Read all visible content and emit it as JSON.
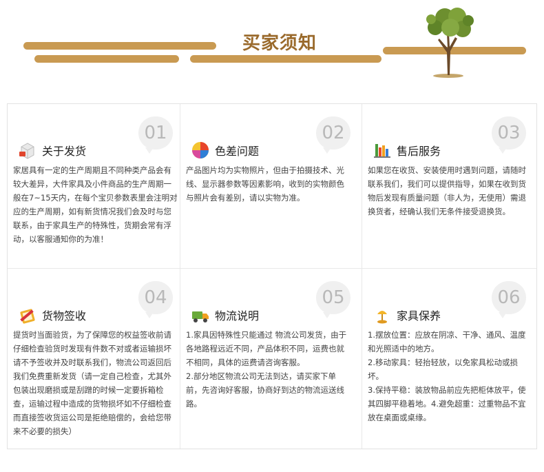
{
  "banner": {
    "title": "买家须知"
  },
  "sections": [
    {
      "number": "01",
      "title": "关于发货",
      "icon": "box-package-icon",
      "text": "家居具有一定的生产周期且不同种类产品会有较大差异，大件家具及小件商品的生产周期一般在7~15天内，在每个宝贝参数表里会注明对应的生产周期，如有新货情况我们会及时与您联系，由于家具生产的特殊性，货期会常有浮动，以客服通知你的为准！"
    },
    {
      "number": "02",
      "title": "色差问题",
      "icon": "color-ball-icon",
      "text": "产品图片均为实物照片，但由于拍摄技术、光线、显示器参数等因素影响，收到的实物颜色与照片会有差别，请以实物为准。"
    },
    {
      "number": "03",
      "title": "售后服务",
      "icon": "cart-icon",
      "text": "如果您在收货、安装使用时遇到问题，请随时联系我们，我们可以提供指导，如果在收到货物后发现有质量问题（非人为，无使用）需退换货者，经确认我们无条件接受退换货。"
    },
    {
      "number": "04",
      "title": "货物签收",
      "icon": "pencil-notepad-icon",
      "text": "提货时当面验货，为了保障您的权益签收前请仔细检查验货时发现有件数不对或者运输损坏请不予签收并及时联系我们，物流公司返回后我们免费重新发货（请一定自己检查，尤其外包装出现磨损或是刮蹭的时候一定要拆箱检查，运输过程中造成的货物损坏如不仔细检查而直接签收货运公司是拒绝赔偿的，会给您带来不必要的损失）"
    },
    {
      "number": "05",
      "title": "物流说明",
      "icon": "delivery-truck-icon",
      "text": "1.家具因特殊性只能通过 物流公司发货，由于各地路程远近不同，产品体积不同，运费也就不相同，具体的运费请咨询客服。\n2.部分地区物流公司无法到达，请买家下单前，先咨询好客服，协商好到达的物流运送线路。"
    },
    {
      "number": "06",
      "title": "家具保养",
      "icon": "lamp-icon",
      "text": "1.摆放位置：应放在阴凉、干净、通风、温度和光照适中的地方。\n2.移动家具：轻抬轻放，以免家具松动或损坏。\n3.保持平稳：装放物品前应先把柜体放平，使其四脚平稳着地。4.避免超重：过重物品不宜放在桌面或桌缘。"
    }
  ]
}
